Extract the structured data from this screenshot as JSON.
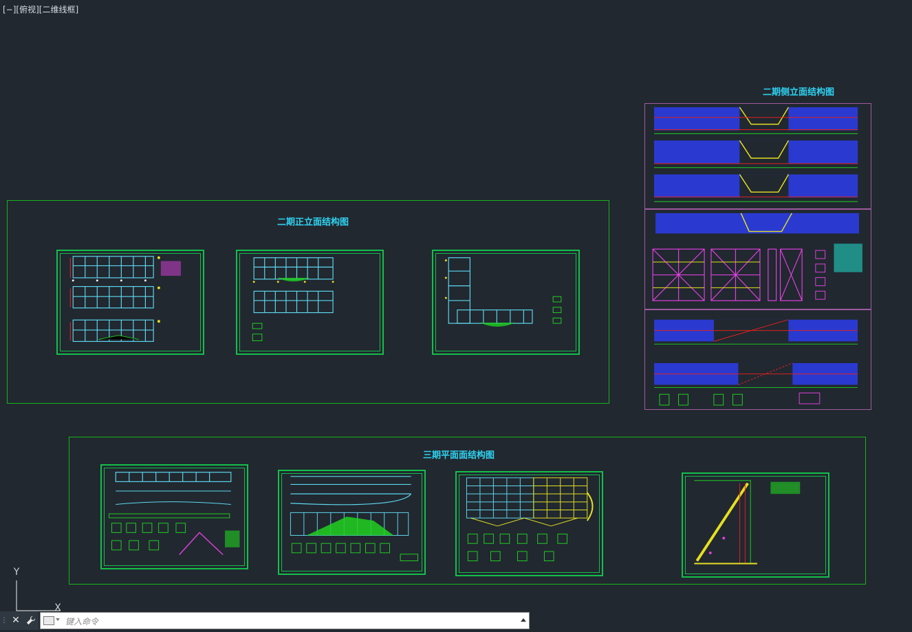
{
  "viewport": {
    "label": "[−][俯视][二维线框]"
  },
  "groups": {
    "front_elevation": {
      "title": "二期正立面结构图"
    },
    "side_elevation": {
      "title": "二期侧立面结构图"
    },
    "plan": {
      "title": "三期平面面结构图"
    }
  },
  "ucs": {
    "y_label": "Y",
    "x_label": "X"
  },
  "command_line": {
    "placeholder": "键入命令",
    "close_symbol": "✕",
    "customize_symbol": "🔧"
  },
  "colors": {
    "background": "#212830",
    "frame_green": "#18b418",
    "title_cyan": "#2fd2f0",
    "frame_magenta": "#a05ba0",
    "member_blue": "#2a3ad0",
    "member_cyan": "#5ed8ef",
    "member_red": "#e02020",
    "member_yellow": "#e6e020",
    "member_green": "#20d020"
  }
}
